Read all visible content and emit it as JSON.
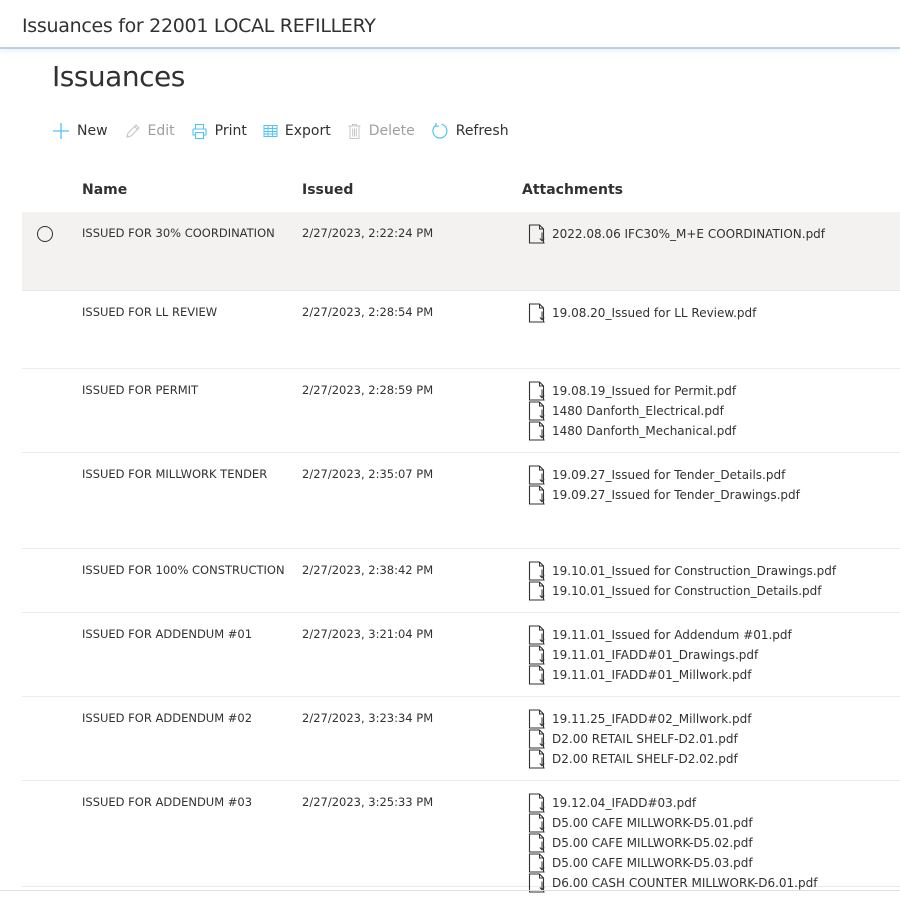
{
  "header": {
    "title": "Issuances for 22001 LOCAL REFILLERY"
  },
  "page": {
    "title": "Issuances"
  },
  "toolbar": {
    "new_label": "New",
    "edit_label": "Edit",
    "print_label": "Print",
    "export_label": "Export",
    "delete_label": "Delete",
    "refresh_label": "Refresh",
    "accent_color": "#4fc3f7",
    "disabled_color": "#a19f9d"
  },
  "table": {
    "columns": [
      "Name",
      "Issued",
      "Attachments"
    ],
    "rows": [
      {
        "name": "ISSUED FOR 30% COORDINATION",
        "issued": "2/27/2023, 2:22:24 PM",
        "selected_hover": true,
        "attachments": [
          "2022.08.06 IFC30%_M+E COORDINATION.pdf"
        ]
      },
      {
        "name": "ISSUED FOR LL REVIEW",
        "issued": "2/27/2023, 2:28:54 PM",
        "attachments": [
          "19.08.20_Issued for LL Review.pdf"
        ]
      },
      {
        "name": "ISSUED FOR PERMIT",
        "issued": "2/27/2023, 2:28:59 PM",
        "attachments": [
          "19.08.19_Issued for Permit.pdf",
          "1480 Danforth_Electrical.pdf",
          "1480 Danforth_Mechanical.pdf"
        ]
      },
      {
        "name": "ISSUED FOR MILLWORK TENDER",
        "issued": "2/27/2023, 2:35:07 PM",
        "attachments": [
          "19.09.27_Issued for Tender_Details.pdf",
          "19.09.27_Issued for Tender_Drawings.pdf"
        ]
      },
      {
        "name": "ISSUED FOR 100% CONSTRUCTION",
        "issued": "2/27/2023, 2:38:42 PM",
        "attachments": [
          "19.10.01_Issued for Construction_Drawings.pdf",
          "19.10.01_Issued for Construction_Details.pdf"
        ]
      },
      {
        "name": "ISSUED FOR ADDENDUM #01",
        "issued": "2/27/2023, 3:21:04 PM",
        "attachments": [
          "19.11.01_Issued for Addendum #01.pdf",
          "19.11.01_IFADD#01_Drawings.pdf",
          "19.11.01_IFADD#01_Millwork.pdf"
        ]
      },
      {
        "name": "ISSUED FOR ADDENDUM #02",
        "issued": "2/27/2023, 3:23:34 PM",
        "attachments": [
          "19.11.25_IFADD#02_Millwork.pdf",
          "D2.00 RETAIL SHELF-D2.01.pdf",
          "D2.00 RETAIL SHELF-D2.02.pdf"
        ]
      },
      {
        "name": "ISSUED FOR ADDENDUM #03",
        "issued": "2/27/2023, 3:25:33 PM",
        "attachments": [
          "19.12.04_IFADD#03.pdf",
          "D5.00 CAFE MILLWORK-D5.01.pdf",
          "D5.00 CAFE MILLWORK-D5.02.pdf",
          "D5.00 CAFE MILLWORK-D5.03.pdf",
          "D6.00 CASH COUNTER MILLWORK-D6.01.pdf"
        ]
      }
    ]
  }
}
